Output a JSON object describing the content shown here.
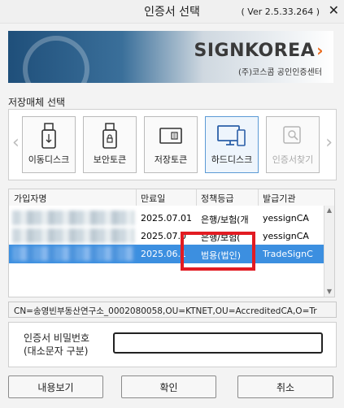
{
  "window": {
    "title": "인증서 선택",
    "version": "( Ver 2.5.33.264 )",
    "close_glyph": "✕"
  },
  "banner": {
    "logo_text": "SIGNKOREA",
    "logo_arrow": "›",
    "subtitle": "(주)코스콤 공인인증센터"
  },
  "media": {
    "section_label": "저장매체 선택",
    "left_arrow": "‹",
    "right_arrow": "›",
    "buttons": [
      {
        "label": "이동디스크",
        "icon": "usb-drive-icon",
        "selected": false,
        "enabled": true
      },
      {
        "label": "보안토큰",
        "icon": "security-token-icon",
        "selected": false,
        "enabled": true
      },
      {
        "label": "저장토큰",
        "icon": "storage-token-icon",
        "selected": false,
        "enabled": true
      },
      {
        "label": "하드디스크",
        "icon": "hard-disk-monitor-icon",
        "selected": true,
        "enabled": true
      },
      {
        "label": "인증서찾기",
        "icon": "find-certificate-icon",
        "selected": false,
        "enabled": false
      }
    ]
  },
  "cert_list": {
    "columns": [
      "가입자명",
      "만료일",
      "정책등급",
      "발급기관"
    ],
    "rows": [
      {
        "subscriber": "",
        "expiry": "2025.07.01",
        "policy": "은행/보험(개",
        "issuer": "yessignCA",
        "selected": false
      },
      {
        "subscriber": "",
        "expiry": "2025.07.0",
        "policy": "은행/보험(",
        "issuer": "yessignCA",
        "selected": false
      },
      {
        "subscriber": "",
        "expiry": "2025.06.1",
        "policy": "범용(법인)",
        "issuer": "TradeSignC",
        "selected": true
      }
    ]
  },
  "dn_info": "CN=송영빈부동산연구소_0002080058,OU=KTNET,OU=AccreditedCA,O=Tr",
  "password": {
    "label_line1": "인증서 비밀번호",
    "label_line2": "(대소문자 구분)",
    "value": ""
  },
  "buttons": {
    "view": "내용보기",
    "ok": "확인",
    "cancel": "취소"
  },
  "colors": {
    "selection": "#3c8fe0",
    "highlight_box": "#e21b22",
    "accent_orange": "#e96a1e"
  }
}
